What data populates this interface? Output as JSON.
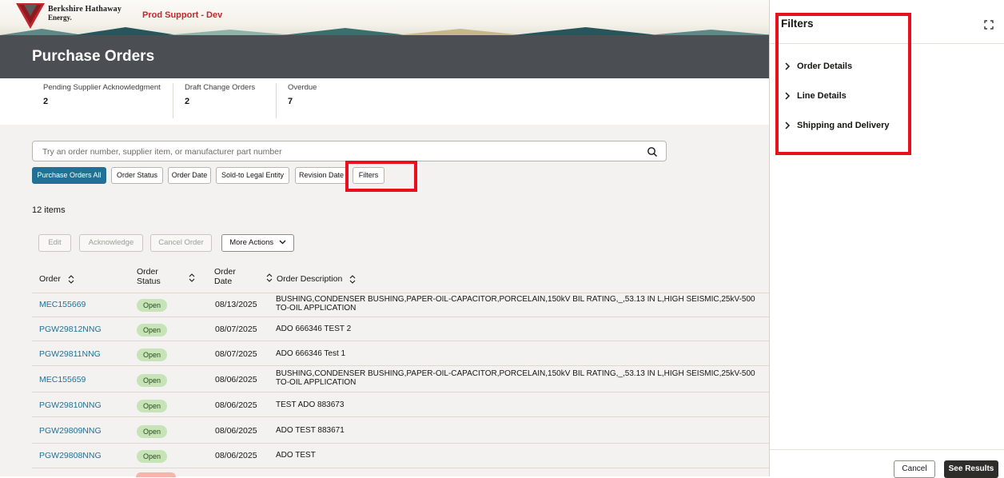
{
  "header": {
    "logo_line1": "Berkshire Hathaway",
    "logo_line2": "Energy.",
    "environment": "Prod Support - Dev"
  },
  "page": {
    "title": "Purchase Orders"
  },
  "metrics": [
    {
      "label": "Pending Supplier Acknowledgment",
      "value": "2"
    },
    {
      "label": "Draft Change Orders",
      "value": "2"
    },
    {
      "label": "Overdue",
      "value": "7"
    }
  ],
  "search": {
    "placeholder": "Try an order number, supplier item, or manufacturer part number",
    "icon": "search-icon"
  },
  "chips": [
    {
      "label": "Purchase Orders All",
      "active": true
    },
    {
      "label": "Order Status"
    },
    {
      "label": "Order Date"
    },
    {
      "label": "Sold-to Legal Entity"
    },
    {
      "label": "Revision Date"
    },
    {
      "label": "Filters"
    }
  ],
  "results": {
    "count_label": "12 items"
  },
  "actions": {
    "edit": "Edit",
    "acknowledge": "Acknowledge",
    "cancel_order": "Cancel Order",
    "more_actions": "More Actions"
  },
  "table": {
    "columns": {
      "order": "Order",
      "status_l1": "Order",
      "status_l2": "Status",
      "date_l1": "Order",
      "date_l2": "Date",
      "description": "Order Description"
    },
    "rows": [
      {
        "order": "MEC155669",
        "status": "Open",
        "date": "08/13/2025",
        "desc1": "BUSHING,CONDENSER BUSHING,PAPER-OIL-CAPACITOR,PORCELAIN,150kV BIL RATING,_,53.13 IN L,HIGH SEISMIC,25kV-500",
        "desc2": "TO-OIL APPLICATION"
      },
      {
        "order": "PGW29812NNG",
        "status": "Open",
        "date": "08/07/2025",
        "desc1": "ADO 666346 TEST 2",
        "desc2": ""
      },
      {
        "order": "PGW29811NNG",
        "status": "Open",
        "date": "08/07/2025",
        "desc1": "ADO 666346 Test 1",
        "desc2": ""
      },
      {
        "order": "MEC155659",
        "status": "Open",
        "date": "08/06/2025",
        "desc1": "BUSHING,CONDENSER BUSHING,PAPER-OIL-CAPACITOR,PORCELAIN,150kV BIL RATING,_,53.13 IN L,HIGH SEISMIC,25kV-500",
        "desc2": "TO-OIL APPLICATION"
      },
      {
        "order": "PGW29810NNG",
        "status": "Open",
        "date": "08/06/2025",
        "desc1": "TEST ADO 883673",
        "desc2": ""
      },
      {
        "order": "PGW29809NNG",
        "status": "Open",
        "date": "08/06/2025",
        "desc1": "ADO TEST 883671",
        "desc2": ""
      },
      {
        "order": "PGW29808NNG",
        "status": "Open",
        "date": "08/06/2025",
        "desc1": "ADO TEST",
        "desc2": ""
      }
    ]
  },
  "drawer": {
    "title": "Filters",
    "sections": [
      "Order Details",
      "Line Details",
      "Shipping and Delivery"
    ],
    "cancel": "Cancel",
    "see_results": "See Results"
  },
  "colors": {
    "accent": "#227093",
    "highlight": "#e8101a",
    "open_badge": "#c7e3b8",
    "title_bar": "#4b4e53"
  }
}
